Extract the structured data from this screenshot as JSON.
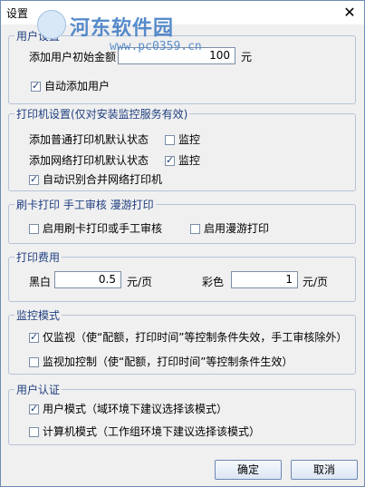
{
  "window": {
    "title": "设置",
    "close_icon": "✕"
  },
  "watermark": {
    "brand": "河东软件园",
    "url": "www.pc0359.cn"
  },
  "user_settings": {
    "legend": "用户设置",
    "initial_amount_label": "添加用户初始金额",
    "initial_amount_value": "100",
    "unit": "元",
    "auto_add_user": {
      "label": "自动添加用户",
      "checked": true
    }
  },
  "printer_settings": {
    "legend": "打印机设置(仅对安装监控服务有效)",
    "local_default_label": "添加普通打印机默认状态",
    "local_monitor": {
      "label": "监控",
      "checked": false
    },
    "network_default_label": "添加网络打印机默认状态",
    "network_monitor": {
      "label": "监控",
      "checked": true
    },
    "auto_merge": {
      "label": "自动识别合并网络打印机",
      "checked": true
    }
  },
  "card_settings": {
    "legend": "刷卡打印 手工审核 漫游打印",
    "card_print": {
      "label": "启用刷卡打印或手工审核",
      "checked": false
    },
    "roaming": {
      "label": "启用漫游打印",
      "checked": false
    }
  },
  "print_fee": {
    "legend": "打印费用",
    "bw_label": "黑白",
    "bw_value": "0.5",
    "bw_unit": "元/页",
    "color_label": "彩色",
    "color_value": "1",
    "color_unit": "元/页"
  },
  "monitor_mode": {
    "legend": "监控模式",
    "monitor_only": {
      "label": "仅监视（使“配额，打印时间”等控制条件失效，手工审核除外）",
      "checked": true
    },
    "monitor_control": {
      "label": "监视加控制（使“配额，打印时间”等控制条件生效）",
      "checked": false
    }
  },
  "user_auth": {
    "legend": "用户认证",
    "user_mode": {
      "label": "用户模式（域环境下建议选择该模式）",
      "checked": true
    },
    "computer_mode": {
      "label": "计算机模式（工作组环境下建议选择该模式）",
      "checked": false
    }
  },
  "buttons": {
    "ok": "确定",
    "cancel": "取消"
  }
}
